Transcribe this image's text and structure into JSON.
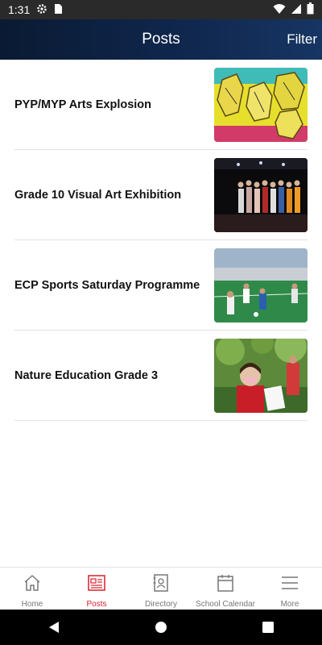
{
  "status_bar": {
    "time": "1:31",
    "icons": [
      "gear-icon",
      "sim-card-icon",
      "wifi-icon",
      "signal-icon",
      "battery-icon"
    ]
  },
  "app_bar": {
    "title": "Posts",
    "filter_label": "Filter"
  },
  "posts": [
    {
      "title": "PYP/MYP Arts Explosion",
      "thumb": "yellow collage artwork"
    },
    {
      "title": "Grade 10 Visual Art Exhibition",
      "thumb": "students on stage"
    },
    {
      "title": "ECP Sports Saturday Programme",
      "thumb": "children on football field"
    },
    {
      "title": "Nature Education Grade 3",
      "thumb": "child holding paper outdoors"
    }
  ],
  "bottom_nav": {
    "items": [
      {
        "label": "Home",
        "icon": "home-icon",
        "active": false
      },
      {
        "label": "Posts",
        "icon": "newspaper-icon",
        "active": true
      },
      {
        "label": "Directory",
        "icon": "contact-book-icon",
        "active": false
      },
      {
        "label": "School Calendar",
        "icon": "calendar-icon",
        "active": false
      },
      {
        "label": "More",
        "icon": "menu-icon",
        "active": false
      }
    ]
  },
  "colors": {
    "accent": "#d81e2c",
    "app_bar": "#10284f",
    "inactive": "#777777"
  }
}
